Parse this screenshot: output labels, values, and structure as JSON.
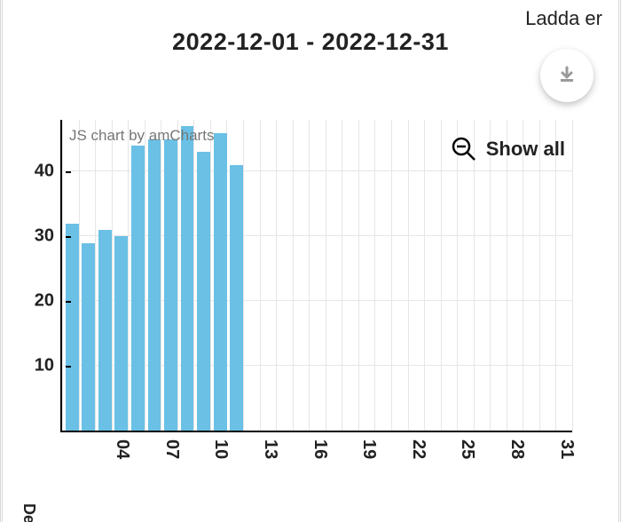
{
  "header": {
    "link_text": "Ladda er"
  },
  "title": "2022-12-01 - 2022-12-31",
  "credit": "JS chart by amCharts",
  "showall_label": "Show all",
  "bottom_partial_label": "De",
  "chart_data": {
    "type": "bar",
    "xlabel": "",
    "ylabel": "",
    "ylim": [
      0,
      48
    ],
    "y_ticks": [
      10,
      20,
      30,
      40
    ],
    "x_tick_labels": [
      "04",
      "07",
      "10",
      "13",
      "16",
      "19",
      "22",
      "25",
      "28",
      "31"
    ],
    "x_tick_positions": [
      4,
      7,
      10,
      13,
      16,
      19,
      22,
      25,
      28,
      31
    ],
    "x_range": [
      1,
      31
    ],
    "categories": [
      1,
      2,
      3,
      4,
      5,
      6,
      7,
      8,
      9,
      10,
      11
    ],
    "values": [
      32,
      29,
      31,
      30,
      44,
      45,
      45,
      47,
      43,
      46,
      41
    ]
  }
}
